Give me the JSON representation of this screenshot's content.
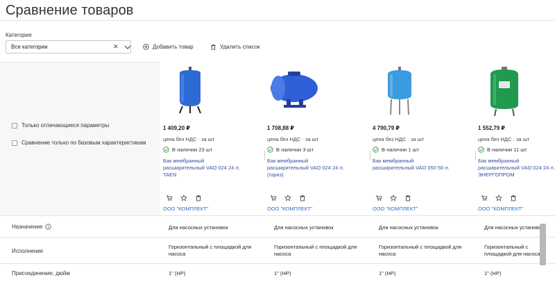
{
  "header": {
    "title": "Сравнение товаров"
  },
  "filters": {
    "category_label": "Категория",
    "category_value": "Все категории",
    "clear_glyph": "✕",
    "add_product": "Добавить товар",
    "delete_list": "Удалить список"
  },
  "options": {
    "only_diff": "Только отличающиеся параметры",
    "only_base": "Сравнение только по базовым характеристикам"
  },
  "products": [
    {
      "price": "1 409,20 ₽",
      "price_note": "цена без НДС · за шт",
      "stock": "В наличии 23 шт",
      "name": "Бак мембранный расширительный VAO 024 24 л. TAEN",
      "seller": "ООО \"КОМПЛЕКТ\"",
      "image_color": "#2d6ad4",
      "image_kind": "vertical-tank"
    },
    {
      "price": "1 708,88 ₽",
      "price_note": "цена без НДС · за шт",
      "stock": "В наличии 3 шт",
      "name": "Бак мембранный расширительный VAO 024 24 л. (гориз)",
      "seller": "ООО \"КОМПЛЕКТ\"",
      "image_color": "#2f5fd6",
      "image_kind": "horizontal-tank"
    },
    {
      "price": "4 790,79 ₽",
      "price_note": "цена без НДС · за шт",
      "stock": "В наличии 1 шт",
      "name": "Бак мембранный расширительный VAO 050 50 л.",
      "seller": "ООО \"КОМПЛЕКТ\"",
      "image_color": "#3a9be0",
      "image_kind": "vertical-tank-legs"
    },
    {
      "price": "1 552,79 ₽",
      "price_note": "цена без НДС · за шт",
      "stock": "В наличии 11 шт",
      "name": "Бак мембранный расширительный VAO 024 24 л. ЭНЕРГОПРОМ",
      "seller": "ООО \"КОМПЛЕКТ\"",
      "image_color": "#1f9a4e",
      "image_kind": "vertical-tank-green"
    }
  ],
  "specs": {
    "purpose": {
      "label": "Назначение",
      "values": [
        "Для насосных установок",
        "Для насосных установок",
        "Для насосных установок",
        "Для насосных установок"
      ]
    },
    "design": {
      "label": "Исполнение",
      "values": [
        "Горизонтальный с площадкой для насоса",
        "Горизонтальный с площадкой для насоса",
        "Горизонтальный с площадкой для насоса",
        "Горизонтальный с площадкой для насоса"
      ]
    },
    "connection": {
      "label": "Присоединение, дюйм",
      "values": [
        "1\" (НР)",
        "1\" (НР)",
        "1\" (НР)",
        "1\" (НР)"
      ]
    }
  },
  "icons": {
    "cart": "cart-icon",
    "favorite": "star-icon",
    "delete": "trash-icon",
    "in_stock": "check-circle-icon",
    "info": "info-icon",
    "add": "plus-circle-icon",
    "chevron": "chevron-down-icon"
  },
  "colors": {
    "link": "#3a4fa0",
    "seller_link": "#2f6fc4",
    "stock_ok": "#2e9b3e",
    "panel_bg": "#f7f7f7"
  }
}
